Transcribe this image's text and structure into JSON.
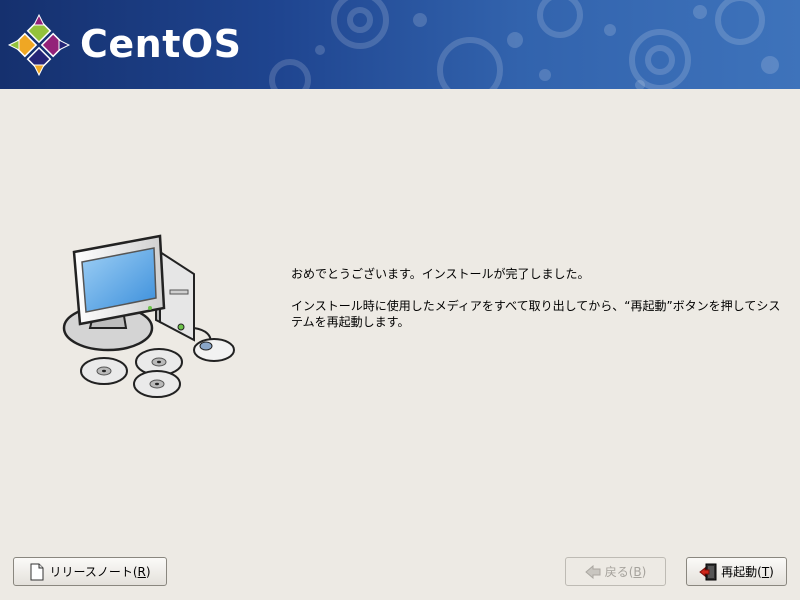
{
  "header": {
    "logo_text": "CentOS",
    "logo_icon": "centos-logo-icon"
  },
  "main": {
    "illustration": "computer-with-discs-icon",
    "message_line1": "おめでとうございます。インストールが完了しました。",
    "message_line2": "インストール時に使用したメディアをすべて取り出してから、“再起動”ボタンを押してシステムを再起動します。"
  },
  "buttons": {
    "release_notes": {
      "prefix": "リリースノート(",
      "mnemonic": "R",
      "suffix": ")",
      "icon": "document-icon"
    },
    "back": {
      "prefix": "戻る(",
      "mnemonic": "B",
      "suffix": ")",
      "icon": "back-arrow-icon",
      "enabled": false
    },
    "reboot": {
      "prefix": "再起動(",
      "mnemonic": "T",
      "suffix": ")",
      "icon": "exit-door-icon"
    }
  },
  "colors": {
    "banner_dark": "#15306e",
    "banner_light": "#3e73bb",
    "background": "#edeae4",
    "logo_green": "#93c23c",
    "logo_purple": "#932279",
    "logo_orange": "#efa724",
    "logo_blue": "#262577"
  }
}
